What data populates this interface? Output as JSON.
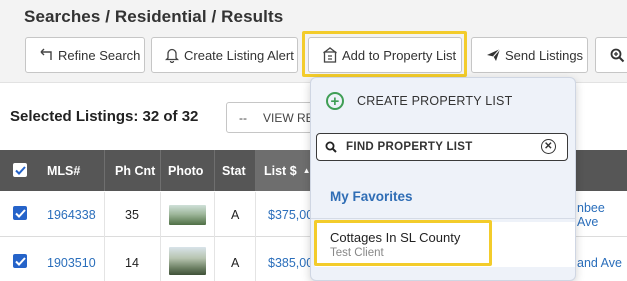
{
  "breadcrumb": "Searches / Residential / Results",
  "toolbar": {
    "refine_search": "Refine Search",
    "create_listing_alert": "Create Listing Alert",
    "add_to_property_list": "Add to Property List",
    "send_listings": "Send Listings"
  },
  "selection": {
    "label": "Selected Listings: 32 of 32"
  },
  "pager": {
    "dash": "--",
    "text": "VIEW RE"
  },
  "table": {
    "headers": {
      "mls": "MLS#",
      "ph_cnt": "Ph Cnt",
      "photo": "Photo",
      "stat": "Stat",
      "list_price": "List $"
    },
    "rows": [
      {
        "mls": "1964338",
        "ph_cnt": "35",
        "stat": "A",
        "list_price": "$375,00",
        "address_fragment": "nbee Ave"
      },
      {
        "mls": "1903510",
        "ph_cnt": "14",
        "stat": "A",
        "list_price": "$385,00",
        "address_fragment": "and Ave"
      }
    ]
  },
  "dropdown": {
    "create_label": "CREATE PROPERTY LIST",
    "search_placeholder": "FIND PROPERTY LIST",
    "favorites_label": "My Favorites",
    "items": [
      {
        "title": "Cottages In SL County",
        "subtitle": "Test Client"
      }
    ]
  },
  "colors": {
    "highlight": "#f3cc2b",
    "link": "#2a6ebb",
    "header_bg": "#565656",
    "checkbox": "#2563c9"
  },
  "icons": [
    "undo-arrow-icon",
    "bell-icon",
    "property-list-icon",
    "paper-plane-icon",
    "zoom-icon",
    "plus-circle-icon",
    "search-icon",
    "clear-icon",
    "checkmark-icon",
    "sort-up-icon"
  ]
}
